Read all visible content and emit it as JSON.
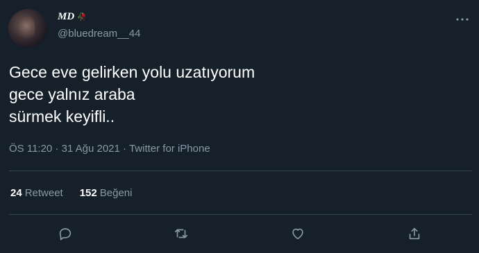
{
  "author": {
    "name": "MD",
    "name_emoji": "🥀",
    "handle": "@bluedream__44"
  },
  "tweet": {
    "text": "Gece eve gelirken yolu uzatıyorum\ngece yalnız araba\nsürmek keyifli..",
    "time": "ÖS 11:20",
    "date": "31 Ağu 2021",
    "source": "Twitter for iPhone",
    "separator": " · "
  },
  "stats": {
    "retweets_count": "24",
    "retweets_label": "Retweet",
    "likes_count": "152",
    "likes_label": "Beğeni"
  },
  "icons": {
    "more": "more-dots-icon",
    "reply": "reply-icon",
    "retweet": "retweet-icon",
    "like": "heart-icon",
    "share": "share-icon"
  },
  "colors": {
    "background": "#15202b",
    "text": "#ffffff",
    "muted": "#8b98a5",
    "divider": "#38444d"
  }
}
